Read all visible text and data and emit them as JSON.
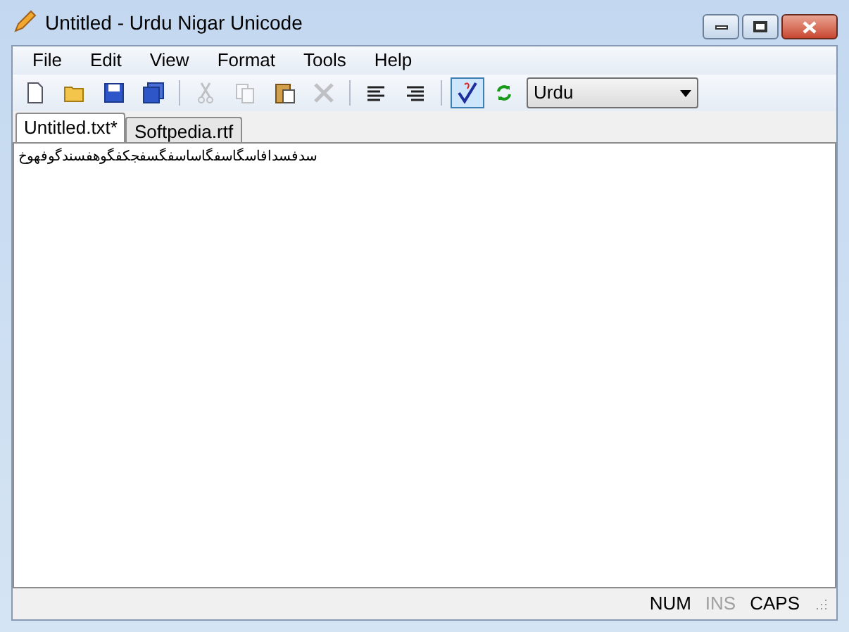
{
  "window": {
    "title": "Untitled - Urdu Nigar Unicode"
  },
  "menu": [
    "File",
    "Edit",
    "View",
    "Format",
    "Tools",
    "Help"
  ],
  "toolbar": [
    {
      "kind": "new",
      "disabled": false
    },
    {
      "kind": "open",
      "disabled": false
    },
    {
      "kind": "save",
      "disabled": false
    },
    {
      "kind": "saveall",
      "disabled": false
    },
    {
      "kind": "sep"
    },
    {
      "kind": "cut",
      "disabled": true
    },
    {
      "kind": "copy",
      "disabled": true
    },
    {
      "kind": "paste",
      "disabled": false
    },
    {
      "kind": "delete",
      "disabled": true
    },
    {
      "kind": "sep"
    },
    {
      "kind": "alignleft",
      "disabled": false
    },
    {
      "kind": "alignright",
      "disabled": false
    },
    {
      "kind": "sep"
    },
    {
      "kind": "spell",
      "disabled": false,
      "pressed": true
    },
    {
      "kind": "refresh",
      "disabled": false
    }
  ],
  "language": {
    "value": "Urdu"
  },
  "tabs": [
    {
      "label": "Untitled.txt*",
      "selected": true
    },
    {
      "label": "Softpedia.rtf",
      "selected": false
    }
  ],
  "editor": {
    "text": "سدفسدافاسگاسفگاساسفگسفجکفگوھفسندگوفھوخ"
  },
  "status": [
    {
      "label": "NUM",
      "on": true
    },
    {
      "label": "INS",
      "on": false
    },
    {
      "label": "CAPS",
      "on": true
    }
  ]
}
